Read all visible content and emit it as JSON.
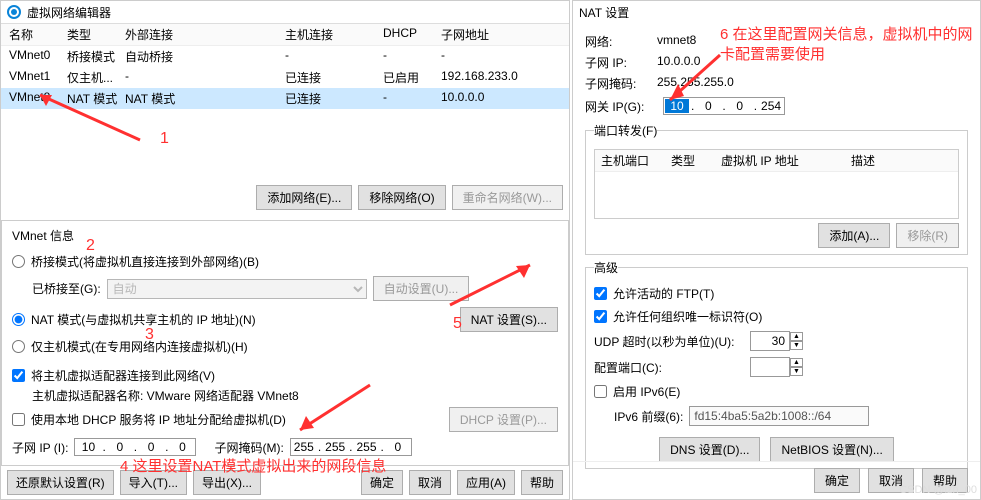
{
  "main": {
    "title": "虚拟网络编辑器",
    "columns": {
      "name": "名称",
      "type": "类型",
      "ext": "外部连接",
      "host": "主机连接",
      "dhcp": "DHCP",
      "subnet": "子网地址"
    },
    "rows": [
      {
        "name": "VMnet0",
        "type": "桥接模式",
        "ext": "自动桥接",
        "host": "-",
        "dhcp": "-",
        "subnet": "-"
      },
      {
        "name": "VMnet1",
        "type": "仅主机...",
        "ext": "-",
        "host": "已连接",
        "dhcp": "已启用",
        "subnet": "192.168.233.0"
      },
      {
        "name": "VMnet8",
        "type": "NAT 模式",
        "ext": "NAT 模式",
        "host": "已连接",
        "dhcp": "-",
        "subnet": "10.0.0.0"
      }
    ],
    "add_net": "添加网络(E)...",
    "remove_net": "移除网络(O)",
    "rename_net": "重命名网络(W)...",
    "vmnet_info": "VMnet 信息",
    "bridge_mode": "桥接模式(将虚拟机直接连接到外部网络)(B)",
    "bridged_to": "已桥接至(G):",
    "auto": "自动",
    "auto_set": "自动设置(U)...",
    "nat_mode": "NAT 模式(与虚拟机共享主机的 IP 地址)(N)",
    "nat_settings": "NAT 设置(S)...",
    "host_only": "仅主机模式(在专用网络内连接虚拟机)(H)",
    "connect_host": "将主机虚拟适配器连接到此网络(V)",
    "adapter_name": "主机虚拟适配器名称: VMware 网络适配器 VMnet8",
    "use_dhcp": "使用本地 DHCP 服务将 IP 地址分配给虚拟机(D)",
    "dhcp_settings": "DHCP 设置(P)...",
    "subnet_ip": "子网 IP (I):",
    "subnet_ip_val": [
      "10",
      "0",
      "0",
      "0"
    ],
    "subnet_mask": "子网掩码(M):",
    "subnet_mask_val": [
      "255",
      "255",
      "255",
      "0"
    ],
    "restore": "还原默认设置(R)",
    "import": "导入(T)...",
    "export": "导出(X)...",
    "ok": "确定",
    "cancel": "取消",
    "apply": "应用(A)",
    "help": "帮助"
  },
  "nat": {
    "title": "NAT 设置",
    "network_label": "网络:",
    "network": "vmnet8",
    "subnet_ip_label": "子网 IP:",
    "subnet_ip": "10.0.0.0",
    "subnet_mask_label": "子网掩码:",
    "subnet_mask": "255.255.255.0",
    "gateway_label": "网关 IP(G):",
    "gateway": [
      "10",
      "0",
      "0",
      "254"
    ],
    "port_fwd": "端口转发(F)",
    "pcols": {
      "hostport": "主机端口",
      "type": "类型",
      "vmip": "虚拟机 IP 地址",
      "desc": "描述"
    },
    "add": "添加(A)...",
    "remove": "移除(R)",
    "advanced": "高级",
    "allow_ftp": "允许活动的 FTP(T)",
    "allow_oui": "允许任何组织唯一标识符(O)",
    "udp_timeout": "UDP 超时(以秒为单位)(U):",
    "udp_val": "30",
    "config_port": "配置端口(C):",
    "config_port_val": "",
    "enable_ipv6": "启用 IPv6(E)",
    "ipv6_prefix": "IPv6 前缀(6):",
    "ipv6_val": "fd15:4ba5:5a2b:1008::/64",
    "dns_settings": "DNS 设置(D)...",
    "netbios": "NetBIOS 设置(N)...",
    "ok": "确定",
    "cancel": "取消",
    "help": "帮助"
  },
  "annotations": {
    "a1": "1",
    "a2": "2",
    "a3": "3",
    "a4": "4  这里设置NAT模式虚拟出来的网段信息",
    "a5": "5",
    "a6": "6 在这里配置网关信息，虚拟机中的网卡配置需要使用"
  },
  "watermark": "CSDN @lzh_00"
}
